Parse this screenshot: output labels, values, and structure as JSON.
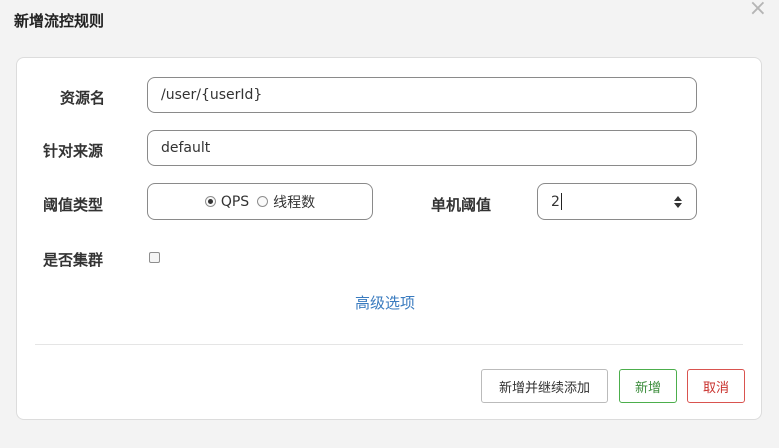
{
  "dialog": {
    "title": "新增流控规则",
    "close_icon": "×"
  },
  "form": {
    "resource": {
      "label": "资源名",
      "value": "/user/{userId}"
    },
    "source": {
      "label": "针对来源",
      "value": "default"
    },
    "threshold_type": {
      "label": "阈值类型",
      "options": [
        {
          "label": "QPS",
          "checked": true
        },
        {
          "label": "线程数",
          "checked": false
        }
      ]
    },
    "single_threshold": {
      "label": "单机阈值",
      "value": "2"
    },
    "cluster": {
      "label": "是否集群",
      "checked": false
    },
    "advanced_link": "高级选项"
  },
  "footer": {
    "add_continue_label": "新增并继续添加",
    "add_label": "新增",
    "cancel_label": "取消"
  },
  "colors": {
    "link": "#3a7bbf",
    "success": "#4cae4c",
    "danger": "#d9534f"
  }
}
